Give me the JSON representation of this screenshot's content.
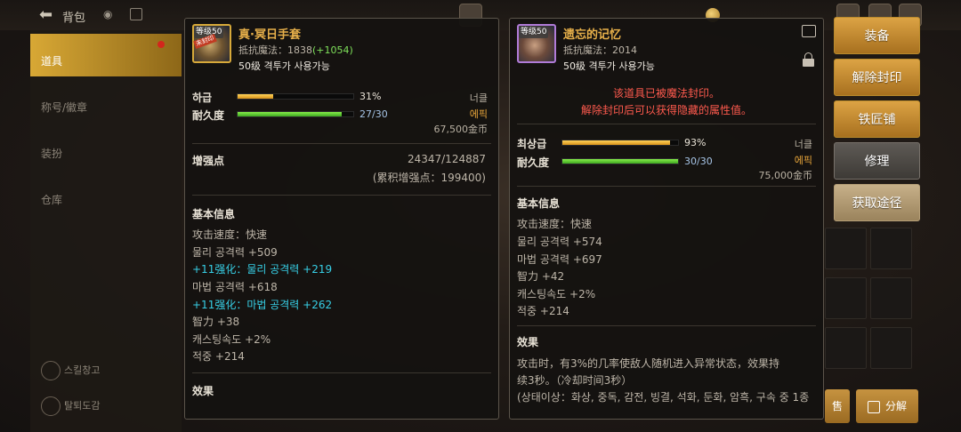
{
  "topbar": {
    "title": "背包",
    "stats": [
      "",
      ""
    ]
  },
  "sidebar": {
    "items": [
      {
        "label": "道具"
      },
      {
        "label": "称号/徽章"
      },
      {
        "label": "装扮"
      },
      {
        "label": "仓库"
      }
    ],
    "bottom": [
      {
        "label": "스킬창고"
      },
      {
        "label": "탈퇴도감"
      }
    ]
  },
  "left_item": {
    "level_badge": "等级50",
    "seal_tag": "未封印",
    "name": "真·冥日手套",
    "resist_label": "抵抗魔法：",
    "resist_value": "1838",
    "resist_bonus": "(+1054)",
    "usable": "50级 격투가 사용가능",
    "grade_label": "하급",
    "grade_pct": 31,
    "grade_text": "31%",
    "durability_label": "耐久度",
    "durability_pct": 0.9,
    "durability_text": "27/30",
    "weight_tag": "너클",
    "rarity": "에픽",
    "price": "67,500金币",
    "reinforce_label": "增强点",
    "reinforce_value": "24347/124887",
    "reinforce_total": "(累积增强点：199400)",
    "basic_title": "基本信息",
    "stats": [
      {
        "text": "攻击速度：快速",
        "style": "normal"
      },
      {
        "text": "물리 공격력 +509",
        "style": "normal"
      },
      {
        "text": "+11强化：물리 공격력 +219",
        "style": "cyan"
      },
      {
        "text": "마법 공격력 +618",
        "style": "normal"
      },
      {
        "text": "+11强化：마법 공격력 +262",
        "style": "cyan"
      },
      {
        "text": "智力 +38",
        "style": "normal"
      },
      {
        "text": "캐스팅속도 +2%",
        "style": "normal"
      },
      {
        "text": "적중 +214",
        "style": "normal"
      }
    ],
    "effect_title": "效果"
  },
  "right_item": {
    "level_badge": "等级50",
    "name": "遗忘的记忆",
    "resist_label": "抵抗魔法：",
    "resist_value": "2014",
    "usable": "50级 격투가 사용가능",
    "seal_line1": "该道具已被魔法封印。",
    "seal_line2": "解除封印后可以获得隐藏的属性值。",
    "grade_label": "최상급",
    "grade_pct": 93,
    "grade_text": "93%",
    "durability_label": "耐久度",
    "durability_pct": 1.0,
    "durability_text": "30/30",
    "weight_tag": "너클",
    "rarity": "에픽",
    "price": "75,000金币",
    "basic_title": "基本信息",
    "stats": [
      {
        "text": "攻击速度：快速"
      },
      {
        "text": "물리 공격력 +574"
      },
      {
        "text": "마법 공격력 +697"
      },
      {
        "text": "智力 +42"
      },
      {
        "text": "캐스팅속도 +2%"
      },
      {
        "text": "적중 +214"
      }
    ],
    "effect_title": "效果",
    "effect_line1": "攻击时，有3%的几率使敌人随机进入异常状态，效果持",
    "effect_line2": "续3秒。（冷却时间3秒）",
    "effect_line3": "(상태이상：화상, 중독, 감전, 빙결, 석화, 둔화, 암흑, 구속 중 1종"
  },
  "actions": {
    "equip": "装备",
    "unseal": "解除封印",
    "blacksmith": "铁匠铺",
    "repair": "修理",
    "acquire": "获取途径"
  },
  "bottom_buttons": {
    "left": "售",
    "right": "分解"
  },
  "colors": {
    "epic": "#e9a63a",
    "gold_button": "#dca344",
    "seal_red": "#ff5a4e",
    "reinforce_cyan": "#37cfe6",
    "bonus_green": "#7ee05a"
  }
}
